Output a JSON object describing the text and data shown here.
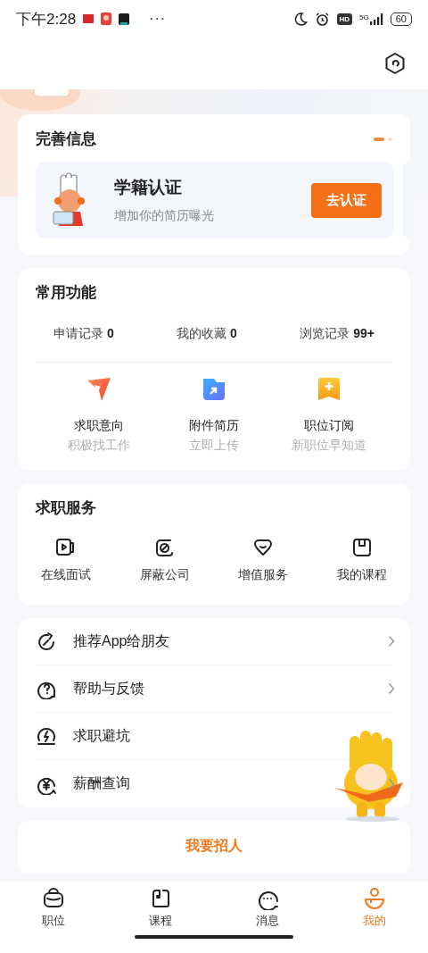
{
  "status_bar": {
    "time": "下午2:28",
    "more": "···",
    "hd": "HD",
    "network": "5G",
    "battery": "60"
  },
  "info_card": {
    "title": "完善信息",
    "dots": [
      {
        "selected": true
      },
      {
        "selected": false
      }
    ],
    "item": {
      "title": "学籍认证",
      "subtitle": "增加你的简历曝光",
      "button": "去认证"
    }
  },
  "common": {
    "title": "常用功能",
    "stats": [
      {
        "label": "申请记录",
        "count": "0"
      },
      {
        "label": "我的收藏",
        "count": "0"
      },
      {
        "label": "浏览记录",
        "count": "99+"
      }
    ],
    "shortcuts": [
      {
        "label": "求职意向",
        "sub": "积极找工作",
        "kind": "send"
      },
      {
        "label": "附件简历",
        "sub": "立即上传",
        "kind": "upload"
      },
      {
        "label": "职位订阅",
        "sub": "新职位早知道",
        "kind": "subscribe"
      }
    ]
  },
  "services": {
    "title": "求职服务",
    "items": [
      {
        "label": "在线面试",
        "kind": "video"
      },
      {
        "label": "屏蔽公司",
        "kind": "block"
      },
      {
        "label": "增值服务",
        "kind": "gift"
      },
      {
        "label": "我的课程",
        "kind": "course"
      }
    ]
  },
  "menu": [
    {
      "label": "推荐App给朋友",
      "kind": "share",
      "chevron": true
    },
    {
      "label": "帮助与反馈",
      "kind": "help",
      "chevron": true
    },
    {
      "label": "求职避坑",
      "kind": "alert",
      "chevron": false
    },
    {
      "label": "薪酬查询",
      "kind": "salary",
      "chevron": true
    }
  ],
  "recruit": {
    "label": "我要招人"
  },
  "tab_bar": [
    {
      "label": "职位",
      "kind": "jobs",
      "selected": false
    },
    {
      "label": "课程",
      "kind": "course",
      "selected": false
    },
    {
      "label": "消息",
      "kind": "message",
      "selected": false
    },
    {
      "label": "我的",
      "kind": "me",
      "selected": true
    }
  ]
}
